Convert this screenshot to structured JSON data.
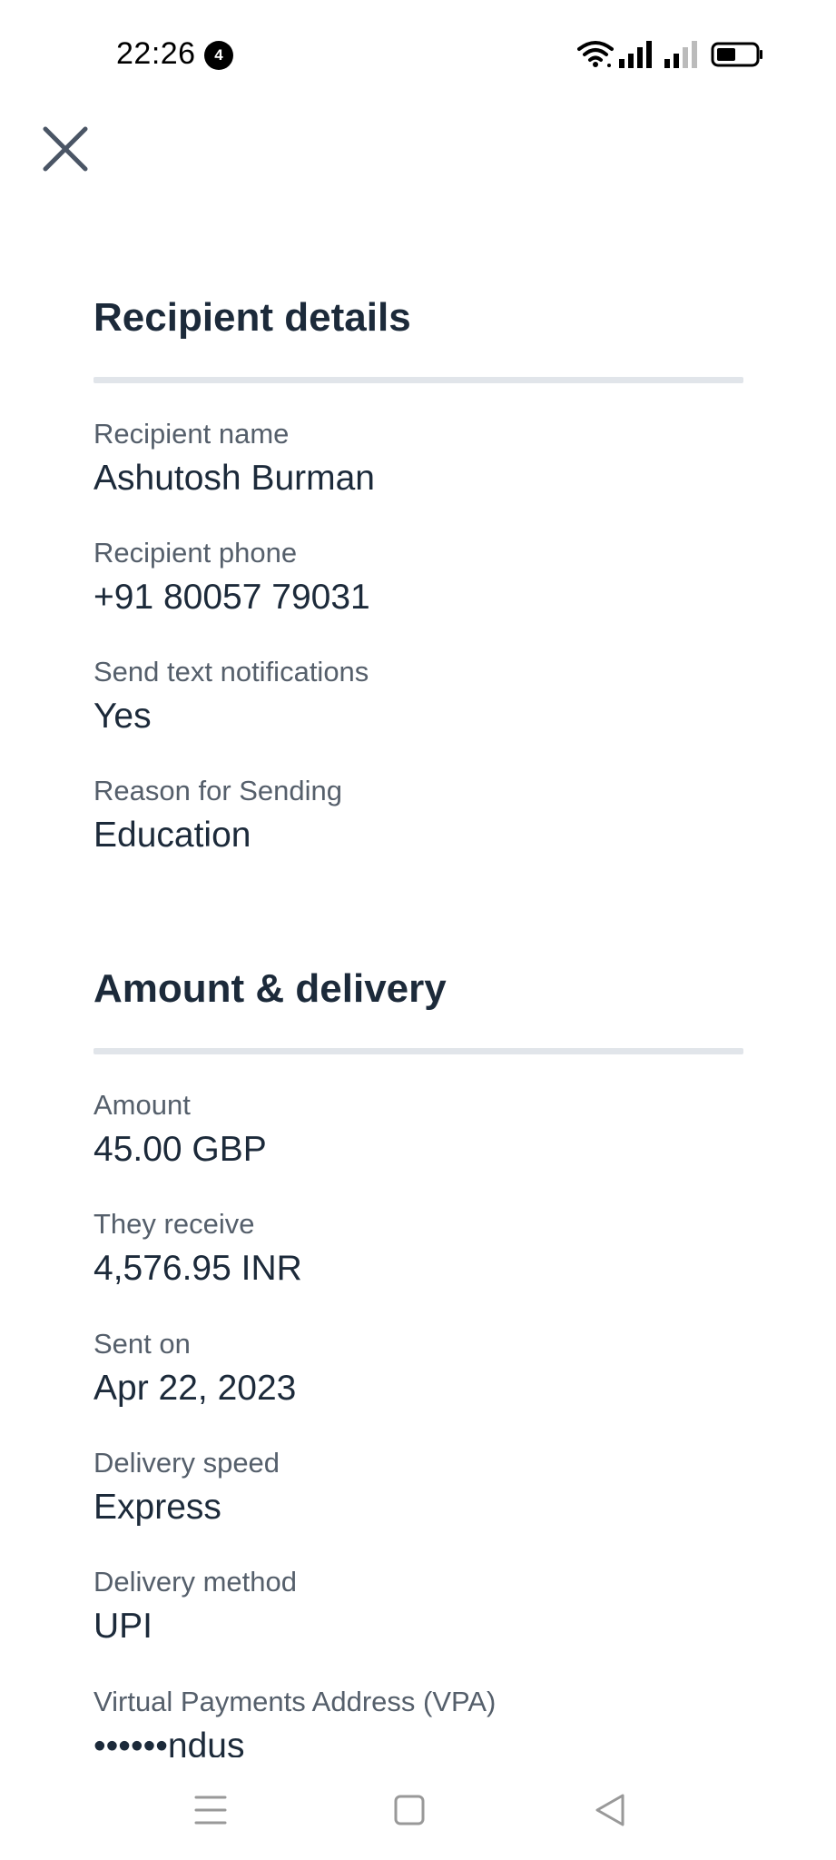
{
  "status_bar": {
    "time": "22:26",
    "notification_count": "4"
  },
  "recipient_section": {
    "title": "Recipient details",
    "fields": [
      {
        "label": "Recipient name",
        "value": "Ashutosh Burman"
      },
      {
        "label": "Recipient phone",
        "value": "+91 80057 79031"
      },
      {
        "label": "Send text notifications",
        "value": "Yes"
      },
      {
        "label": "Reason for Sending",
        "value": "Education"
      }
    ]
  },
  "amount_section": {
    "title": "Amount & delivery",
    "fields": [
      {
        "label": "Amount",
        "value": "45.00 GBP"
      },
      {
        "label": "They receive",
        "value": "4,576.95 INR"
      },
      {
        "label": "Sent on",
        "value": "Apr 22, 2023"
      },
      {
        "label": "Delivery speed",
        "value": "Express"
      },
      {
        "label": "Delivery method",
        "value": "UPI"
      },
      {
        "label": "Virtual Payments Address (VPA)",
        "value": "••••••ndus"
      }
    ]
  },
  "icons": {
    "close": "close-icon",
    "wifi": "wifi-icon",
    "signal": "signal-icon",
    "battery": "battery-icon",
    "menu": "menu-icon",
    "home": "home-icon",
    "back": "back-icon"
  },
  "colors": {
    "heading": "#1c2a3a",
    "label": "#555f6b",
    "divider": "#e1e5ea",
    "icon": "#4a5565"
  }
}
